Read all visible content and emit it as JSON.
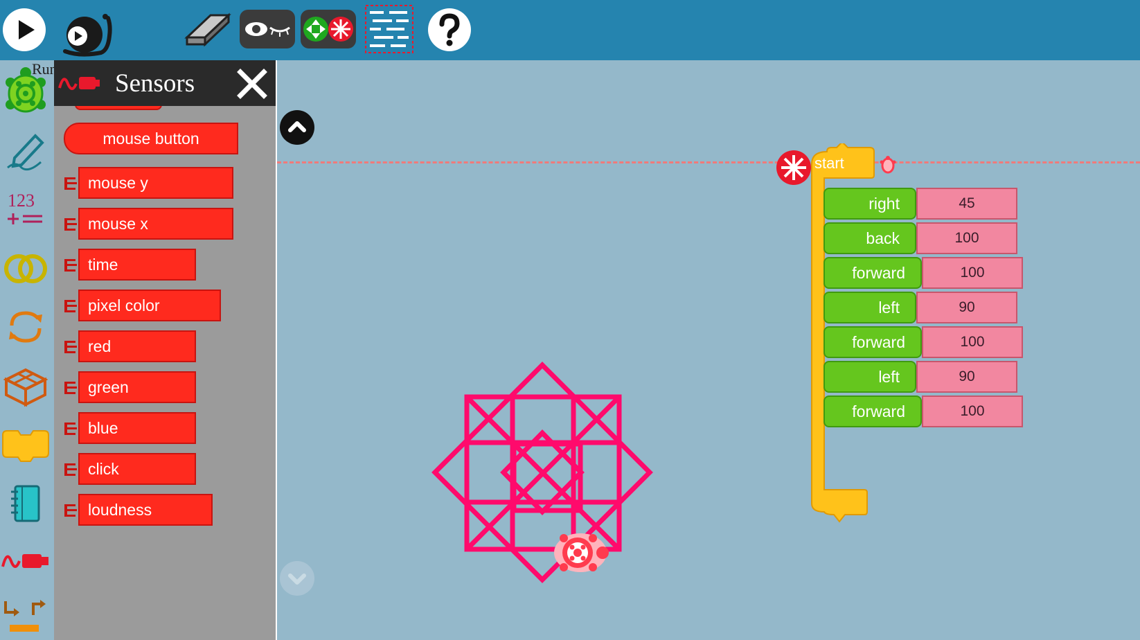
{
  "toolbar": {
    "run_fast_label": "Run",
    "run_slow_label": "Run slow",
    "clear_label": "Clean",
    "show_hide_label": "Show / hide blocks",
    "collapse_label": "Expand / collapse",
    "grid_label": "Grid",
    "help_label": "Help"
  },
  "sidebar": {
    "tooltip": "Run",
    "items": [
      {
        "name": "turtle-palette",
        "icon": "turtle-icon"
      },
      {
        "name": "pen-palette",
        "icon": "pen-icon"
      },
      {
        "name": "number-palette",
        "icon": "number-icon"
      },
      {
        "name": "boolean-palette",
        "icon": "boolean-icon"
      },
      {
        "name": "flow-palette",
        "icon": "flow-icon"
      },
      {
        "name": "boxes-palette",
        "icon": "box-icon"
      },
      {
        "name": "action-palette",
        "icon": "action-icon"
      },
      {
        "name": "media-palette",
        "icon": "media-icon"
      },
      {
        "name": "sensors-palette",
        "icon": "sensor-icon"
      },
      {
        "name": "extras-palette",
        "icon": "extras-icon"
      }
    ]
  },
  "palette": {
    "title": "Sensors",
    "blocks": [
      {
        "label": "mouse button"
      },
      {
        "label": "mouse y"
      },
      {
        "label": "mouse x"
      },
      {
        "label": "time"
      },
      {
        "label": "pixel color"
      },
      {
        "label": "red"
      },
      {
        "label": "green"
      },
      {
        "label": "blue"
      },
      {
        "label": "click"
      },
      {
        "label": "loudness"
      }
    ]
  },
  "program": {
    "start_label": "start",
    "steps": [
      {
        "command": "right",
        "value": "45"
      },
      {
        "command": "back",
        "value": "100"
      },
      {
        "command": "forward",
        "value": "100"
      },
      {
        "command": "left",
        "value": "90"
      },
      {
        "command": "forward",
        "value": "100"
      },
      {
        "command": "left",
        "value": "90"
      },
      {
        "command": "forward",
        "value": "100"
      }
    ]
  },
  "colors": {
    "toolbar": "#2584af",
    "canvas": "#94b8ca",
    "palette_bg": "#9b9b9b",
    "sensor_block": "#ff2a1e",
    "turtle_block": "#65c61e",
    "number_block": "#f287a0",
    "start_block": "#ffc21a",
    "drawing": "#ff0a6c"
  }
}
